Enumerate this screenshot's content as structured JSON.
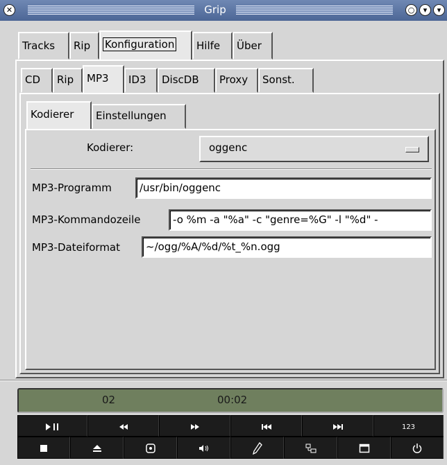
{
  "window": {
    "title": "Grip"
  },
  "main_tabs": [
    {
      "label": "Tracks"
    },
    {
      "label": "Rip"
    },
    {
      "label": "Konfiguration"
    },
    {
      "label": "Hilfe"
    },
    {
      "label": "Über"
    }
  ],
  "config_tabs": [
    {
      "label": "CD"
    },
    {
      "label": "Rip"
    },
    {
      "label": "MP3"
    },
    {
      "label": "ID3"
    },
    {
      "label": "DiscDB"
    },
    {
      "label": "Proxy"
    },
    {
      "label": "Sonst."
    }
  ],
  "mp3_tabs": [
    {
      "label": "Kodierer"
    },
    {
      "label": "Einstellungen"
    }
  ],
  "encoder": {
    "label": "Kodierer:",
    "value": "oggenc"
  },
  "fields": {
    "program": {
      "label": "MP3-Programm",
      "value": "/usr/bin/oggenc"
    },
    "cmdline": {
      "label": "MP3-Kommandozeile",
      "value": "-o %m -a \"%a\" -c \"genre=%G\" -l \"%d\" -"
    },
    "fileformat": {
      "label": "MP3-Dateiformat",
      "value": "~/ogg/%A/%d/%t_%n.ogg"
    }
  },
  "status": {
    "track": "02",
    "time": "00:02"
  },
  "controls_row1": [
    {
      "icon": "play-pause-icon"
    },
    {
      "icon": "rewind-icon"
    },
    {
      "icon": "fast-forward-icon"
    },
    {
      "icon": "previous-track-icon"
    },
    {
      "icon": "next-track-icon"
    },
    {
      "icon": "track-order-icon",
      "text": "123"
    }
  ],
  "controls_row2": [
    {
      "icon": "stop-icon"
    },
    {
      "icon": "eject-icon"
    },
    {
      "icon": "disc-icon"
    },
    {
      "icon": "volume-icon"
    },
    {
      "icon": "edit-icon"
    },
    {
      "icon": "toggle-view-icon"
    },
    {
      "icon": "window-icon"
    },
    {
      "icon": "power-icon"
    }
  ]
}
